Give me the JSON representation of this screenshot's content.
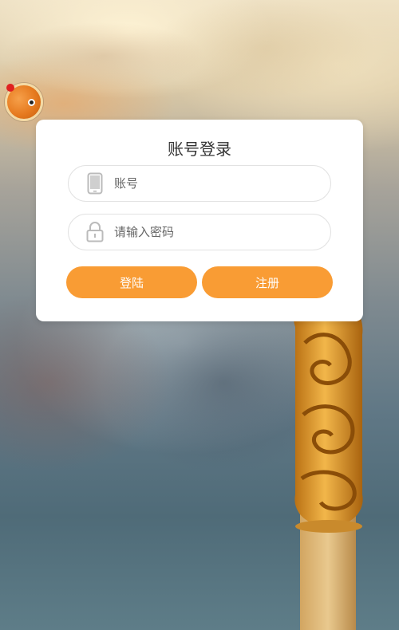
{
  "card": {
    "title": "账号登录",
    "account_placeholder": "账号",
    "password_placeholder": "请输入密码",
    "login_label": "登陆",
    "register_label": "注册"
  },
  "colors": {
    "accent": "#f99c34",
    "card_bg": "#ffffff",
    "notification_dot": "#e02020"
  },
  "icons": {
    "account": "phone-icon",
    "password": "lock-icon"
  }
}
